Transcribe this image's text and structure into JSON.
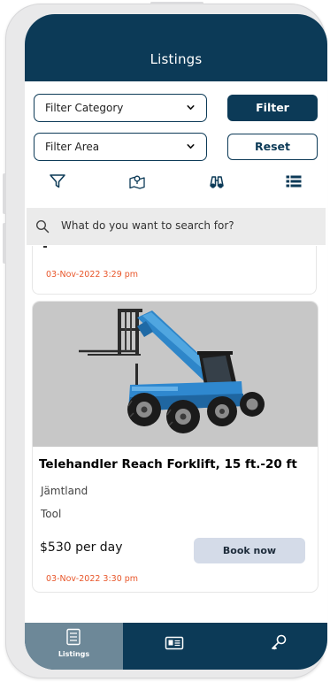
{
  "header": {
    "title": "Listings"
  },
  "filters": {
    "category_label": "Filter Category",
    "area_label": "Filter Area",
    "filter_button": "Filter",
    "reset_button": "Reset"
  },
  "toolbar": {
    "icons": [
      "filter-icon",
      "map-icon",
      "binoculars-icon",
      "list-icon"
    ]
  },
  "search": {
    "placeholder": "What do you want to search for?"
  },
  "listings": [
    {
      "date": "03-Nov-2022 3:29 pm"
    },
    {
      "title": "Telehandler Reach Forklift, 15 ft.-20 ft",
      "location": "Jämtland",
      "category": "Tool",
      "price": "$530 per day",
      "book_label": "Book now",
      "date": "03-Nov-2022 3:30 pm"
    }
  ],
  "tabbar": {
    "tabs": [
      {
        "label": "Listings",
        "icon": "listings-icon",
        "active": true
      },
      {
        "label": "",
        "icon": "card-icon",
        "active": false
      },
      {
        "label": "",
        "icon": "key-icon",
        "active": false
      }
    ]
  },
  "colors": {
    "primary": "#0c3a57",
    "tab_active": "#6d8898",
    "date_accent": "#e8572b",
    "book_button": "#d4dbe8"
  }
}
